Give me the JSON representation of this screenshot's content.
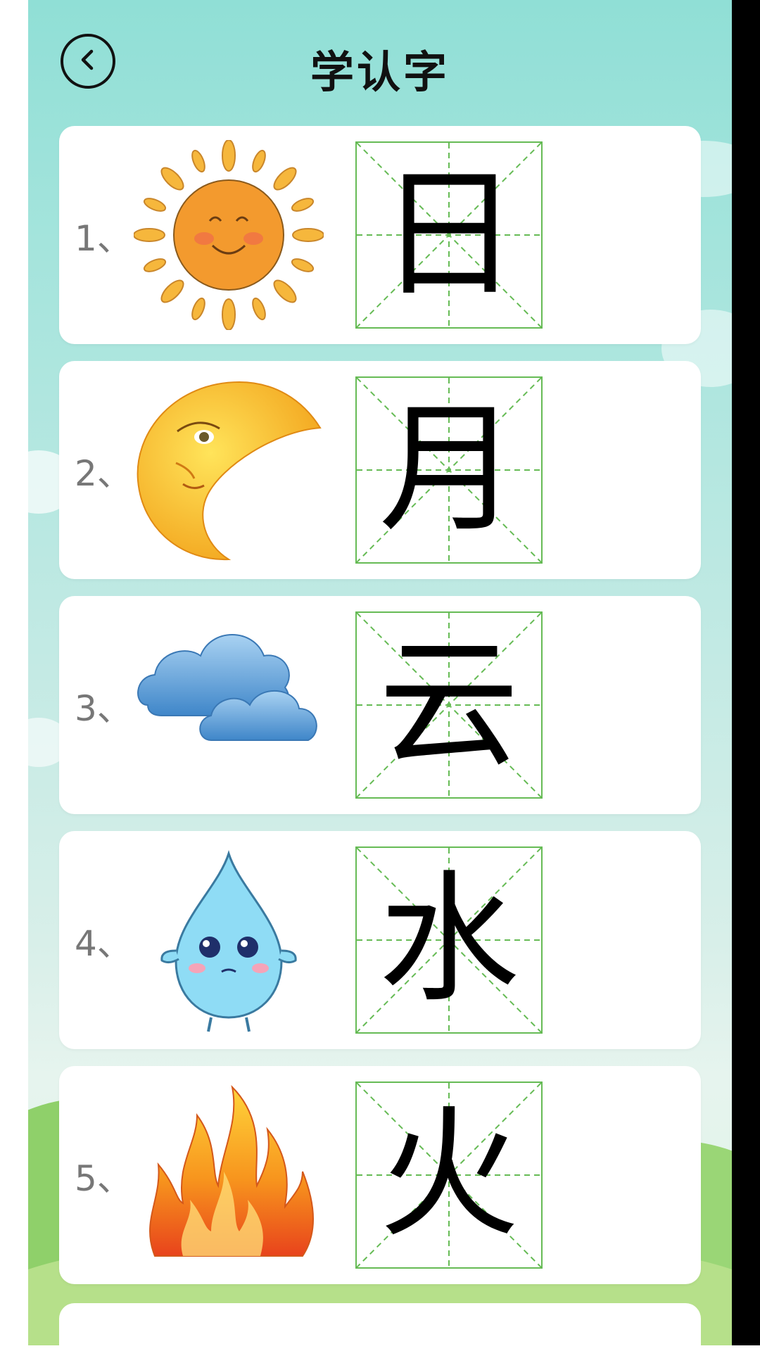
{
  "header": {
    "title": "学认字"
  },
  "icons": {
    "back": "chevron-left-icon"
  },
  "colors": {
    "background_top": "#90dfd6",
    "card": "#ffffff",
    "grid_line": "#66bb55",
    "number_text": "#777777"
  },
  "cards": [
    {
      "index": "1、",
      "character": "日",
      "image": "sun-icon"
    },
    {
      "index": "2、",
      "character": "月",
      "image": "moon-icon"
    },
    {
      "index": "3、",
      "character": "云",
      "image": "cloud-icon"
    },
    {
      "index": "4、",
      "character": "水",
      "image": "water-drop-icon"
    },
    {
      "index": "5、",
      "character": "火",
      "image": "fire-icon"
    }
  ]
}
